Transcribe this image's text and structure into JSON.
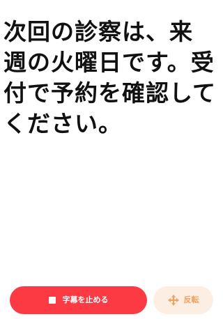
{
  "caption": {
    "text": "次回の診察は、来週の火曜日です。受付で予約を確認してください。"
  },
  "controls": {
    "stop_button": {
      "label": "字幕を止める",
      "icon": "stop-square-icon",
      "background_color": "#fb3a44"
    },
    "flip_button": {
      "label": "反転",
      "icon": "move-arrows-icon",
      "background_color": "#fdeee3",
      "text_color": "#f5a05c"
    }
  }
}
